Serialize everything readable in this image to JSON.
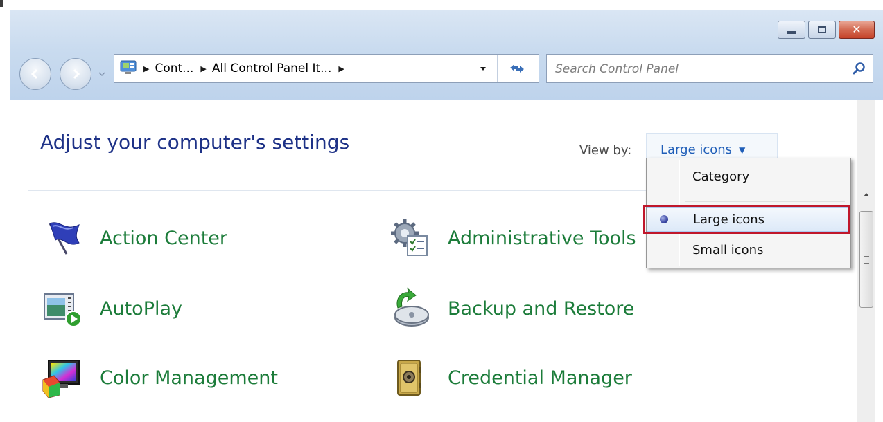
{
  "window": {
    "controls": {
      "minimize": "minimize",
      "maximize": "maximize",
      "close": "✕"
    }
  },
  "address": {
    "crumbs": [
      "Cont...",
      "All Control Panel It..."
    ]
  },
  "search": {
    "placeholder": "Search Control Panel",
    "value": ""
  },
  "header": {
    "title": "Adjust your computer's settings",
    "view_by_label": "View by:",
    "view_by_value": "Large icons"
  },
  "view_menu": {
    "options": [
      "Category",
      "Large icons",
      "Small icons"
    ],
    "selected": "Large icons"
  },
  "items": [
    {
      "label": "Action Center",
      "icon": "flag-icon"
    },
    {
      "label": "Administrative Tools",
      "icon": "admin-tools-icon"
    },
    {
      "label": "AutoPlay",
      "icon": "autoplay-icon"
    },
    {
      "label": "Backup and Restore",
      "icon": "backup-icon"
    },
    {
      "label": "Color Management",
      "icon": "color-management-icon"
    },
    {
      "label": "Credential Manager",
      "icon": "vault-icon"
    }
  ],
  "colors": {
    "title": "#1e3287",
    "item_link": "#1c7c3a",
    "highlight": "#c0172b",
    "view_by_link": "#1f5eb8"
  }
}
